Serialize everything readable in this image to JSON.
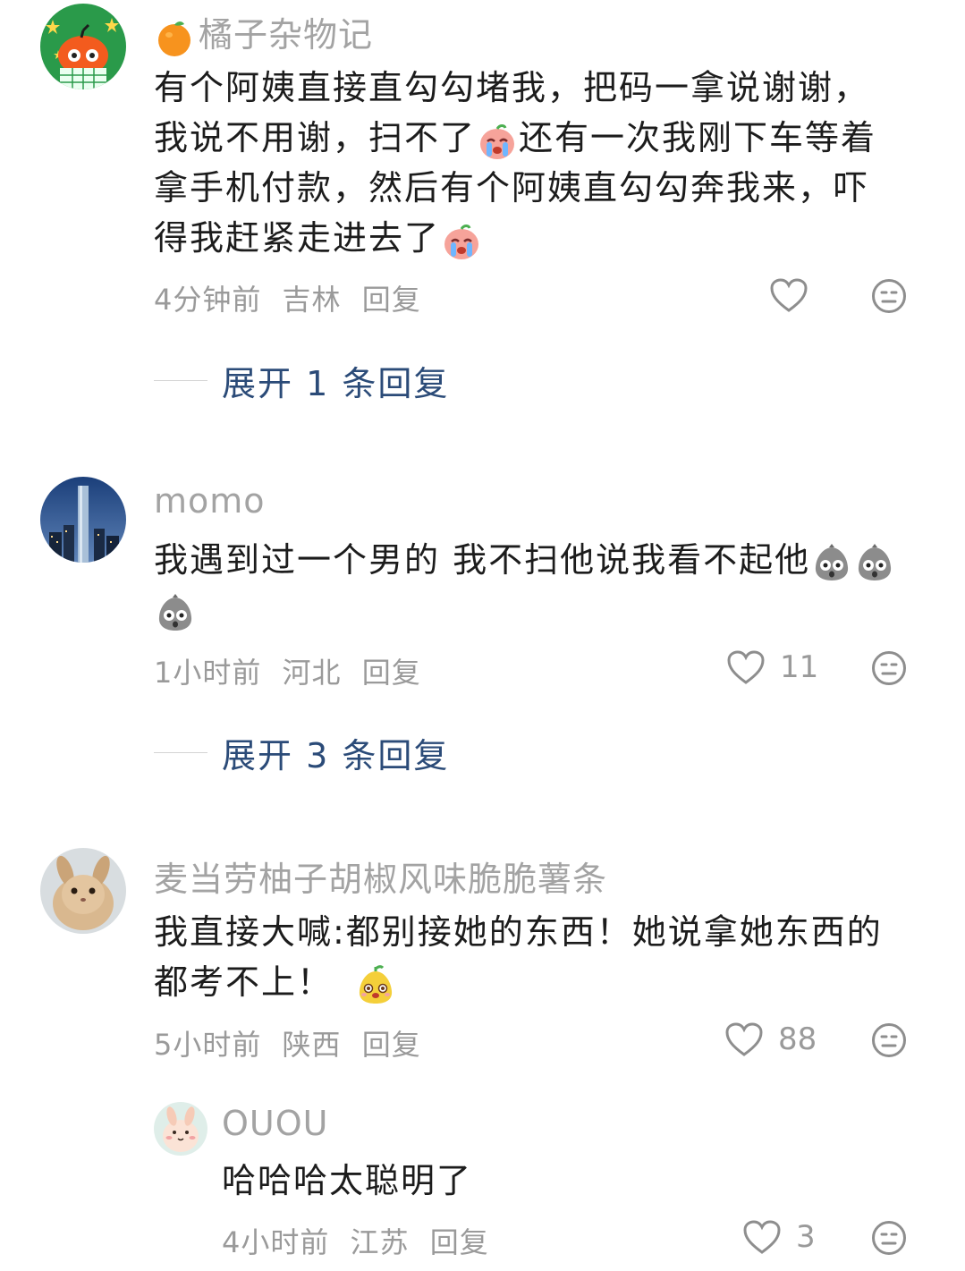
{
  "comments": [
    {
      "username": "橘子杂物记",
      "username_badge": "orange-emoji",
      "lines": [
        "有个阿姨直接直勾勾堵我，把码一拿说谢谢，",
        "我说不用谢，扫不了",
        "还有一次我刚下车等着",
        "拿手机付款，然后有个阿姨直勾勾奔我来，吓",
        "得我赶紧走进去了"
      ],
      "time": "4分钟前",
      "location": "吉林",
      "reply": "回复",
      "likes": "",
      "expand": "展开 1 条回复"
    },
    {
      "username": "momo",
      "lines": [
        "我遇到过一个男的 我不扫他说我看不起他"
      ],
      "time": "1小时前",
      "location": "河北",
      "reply": "回复",
      "likes": "11",
      "expand": "展开 3 条回复"
    },
    {
      "username": "麦当劳柚子胡椒风味脆脆薯条",
      "lines": [
        "我直接大喊:都别接她的东西！她说拿她东西的",
        "都考不上！"
      ],
      "time": "5小时前",
      "location": "陕西",
      "reply": "回复",
      "likes": "88"
    },
    {
      "username": "OUOU",
      "lines": [
        "哈哈哈太聪明了"
      ],
      "time": "4小时前",
      "location": "江苏",
      "reply": "回复",
      "likes": "3"
    }
  ],
  "icons": {
    "like": "heart-outline-icon",
    "dislike": "meh-face-icon",
    "emoji_cry": "crying-peach-emoji",
    "emoji_stone": "shocked-stone-emoji",
    "emoji_pear": "smiling-pear-emoji"
  },
  "colors": {
    "text": "#1c1c1c",
    "muted": "#9a9a9a",
    "expand": "#2b4b78"
  }
}
